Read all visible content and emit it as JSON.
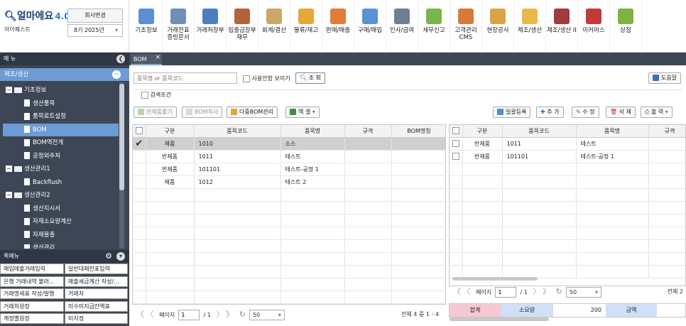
{
  "brand": {
    "logo": "얼마에요",
    "version": "4.0",
    "company": "아이퀘스트",
    "change_company_label": "회사변경",
    "period": "8기 2025년"
  },
  "top_menu": [
    {
      "label": "기초정보",
      "color": "#5b8fd1"
    },
    {
      "label": "거래전표\n증빙문서",
      "color": "#6f8fb5"
    },
    {
      "label": "거래처장부",
      "color": "#4d7fc0"
    },
    {
      "label": "입출금장부\n재무",
      "color": "#b3623a"
    },
    {
      "label": "회계/결산",
      "color": "#c8a96a"
    },
    {
      "label": "물류/재고",
      "color": "#e5a83a"
    },
    {
      "label": "판매/매출",
      "color": "#e07d3a"
    },
    {
      "label": "구매/매입",
      "color": "#5a92d6"
    },
    {
      "label": "인사/급여",
      "color": "#6f7f95"
    },
    {
      "label": "세무신고",
      "color": "#7bb54a"
    },
    {
      "label": "고객관리\nCMS",
      "color": "#d67a3a"
    },
    {
      "label": "현장공사",
      "color": "#d9a441"
    },
    {
      "label": "제조/생산",
      "color": "#e8b94a"
    },
    {
      "label": "제조/생산 II",
      "color": "#a23b3b"
    },
    {
      "label": "이커머스",
      "color": "#c33a3a"
    },
    {
      "label": "상점",
      "color": "#7cb342"
    }
  ],
  "sidebar": {
    "header": "메 뉴",
    "section": "제조/생산",
    "tree": [
      {
        "label": "기초정보",
        "type": "folder"
      },
      {
        "label": "생산품목",
        "type": "page"
      },
      {
        "label": "품목로트설정",
        "type": "page"
      },
      {
        "label": "BOM",
        "type": "page",
        "selected": true
      },
      {
        "label": "BOM역전개",
        "type": "page"
      },
      {
        "label": "공정외주처",
        "type": "page"
      },
      {
        "label": "생산관리1",
        "type": "folder"
      },
      {
        "label": "Backflush",
        "type": "page"
      },
      {
        "label": "생산관리2",
        "type": "folder"
      },
      {
        "label": "생산지시서",
        "type": "page"
      },
      {
        "label": "자재소요량계산",
        "type": "page"
      },
      {
        "label": "자재불출",
        "type": "page"
      },
      {
        "label": "생산관리",
        "type": "page"
      }
    ],
    "quick_header": "퀵메뉴",
    "quick": [
      "매입매출거래입력",
      "일반대체전표입력",
      "은행 거래내역 불러...",
      "매출세금계산 작성/...",
      "거래명세표 작성/발행",
      "거래처",
      "거래처원장",
      "미수미지급잔액표",
      "계정별원장",
      "미지정"
    ]
  },
  "tab": {
    "label": "BOM",
    "close": "×"
  },
  "search": {
    "placeholder": "품목명 or 품목코드",
    "show_unused": "사용안함 보이기",
    "search_btn": "조 회",
    "help": "도움말",
    "condition": "검색조건"
  },
  "left_toolbar": {
    "b1": "반제품풀기",
    "b2": "BOM복사",
    "b3": "다중BOM관리",
    "b4": "엑 셀"
  },
  "right_toolbar": {
    "b1": "일괄등록",
    "b2": "추 가",
    "b3": "수 정",
    "b4": "삭 제",
    "b5": "출 력"
  },
  "left_grid": {
    "columns": [
      "구분",
      "품목코드",
      "품목명",
      "규격",
      "BOM명칭"
    ],
    "rows": [
      {
        "type": "제품",
        "code": "1010",
        "name": "소스",
        "spec": "",
        "bom": "",
        "selected": true
      },
      {
        "type": "반제품",
        "code": "1011",
        "name": "테스트",
        "spec": "",
        "bom": ""
      },
      {
        "type": "반제품",
        "code": "101101",
        "name": "테스트-공정 1",
        "spec": "",
        "bom": ""
      },
      {
        "type": "제품",
        "code": "1012",
        "name": "테스트 2",
        "spec": "",
        "bom": ""
      }
    ],
    "pager": {
      "page_label": "페이지",
      "page": "1",
      "total_pages": "/ 1",
      "size": "50",
      "summary": "전체 4 중 1 - 4"
    }
  },
  "right_grid": {
    "columns": [
      "구분",
      "품목코드",
      "품목명",
      "규격"
    ],
    "rows": [
      {
        "type": "반제품",
        "code": "1011",
        "name": "테스트",
        "spec": ""
      },
      {
        "type": "반제품",
        "code": "101101",
        "name": "테스트-공정 1",
        "spec": ""
      }
    ],
    "pager": {
      "page_label": "페이지",
      "page": "1",
      "total_pages": "/ 1",
      "size": "50",
      "summary": "전체 2"
    },
    "footer": {
      "total_label": "합계",
      "qty_label": "소요량",
      "qty_value": "200",
      "amount_label": "금액"
    }
  }
}
